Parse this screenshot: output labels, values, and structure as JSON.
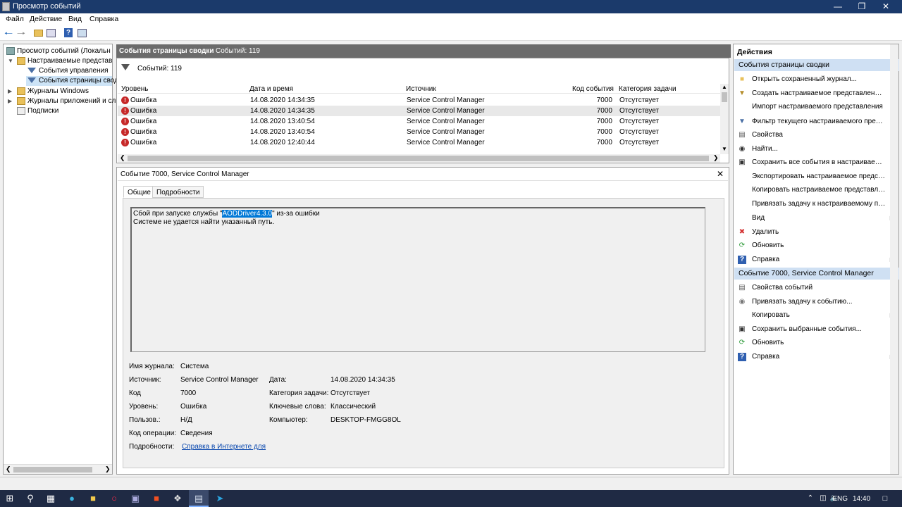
{
  "window": {
    "title": "Просмотр событий"
  },
  "menu": [
    "Файл",
    "Действие",
    "Вид",
    "Справка"
  ],
  "tree": {
    "root": "Просмотр событий (Локальн",
    "custom_views": "Настраиваемые представ",
    "admin_events": "События управления",
    "summary_events": "События страницы свод",
    "windows_logs": "Журналы Windows",
    "app_logs": "Журналы приложений и сл",
    "subscriptions": "Подписки"
  },
  "middle": {
    "header_title": "События страницы сводки",
    "header_count": "Событий: 119",
    "filter_count": "Событий: 119",
    "columns": [
      "Уровень",
      "Дата и время",
      "Источник",
      "Код события",
      "Категория задачи"
    ],
    "rows": [
      {
        "level": "Ошибка",
        "date": "14.08.2020 14:34:35",
        "source": "Service Control Manager",
        "code": "7000",
        "category": "Отсутствует"
      },
      {
        "level": "Ошибка",
        "date": "14.08.2020 14:34:35",
        "source": "Service Control Manager",
        "code": "7000",
        "category": "Отсутствует"
      },
      {
        "level": "Ошибка",
        "date": "14.08.2020 13:40:54",
        "source": "Service Control Manager",
        "code": "7000",
        "category": "Отсутствует"
      },
      {
        "level": "Ошибка",
        "date": "14.08.2020 13:40:54",
        "source": "Service Control Manager",
        "code": "7000",
        "category": "Отсутствует"
      },
      {
        "level": "Ошибка",
        "date": "14.08.2020 12:40:44",
        "source": "Service Control Manager",
        "code": "7000",
        "category": "Отсутствует"
      }
    ]
  },
  "detail": {
    "title": "Событие 7000, Service Control Manager",
    "tabs": [
      "Общие",
      "Подробности"
    ],
    "msg_pre": "Сбой при запуске службы \"",
    "msg_sel": "AODDriver4.3.0",
    "msg_post": "\" из-за ошибки",
    "msg_line2": "Системе не удается найти указанный путь.",
    "fields": {
      "log_label": "Имя журнала:",
      "log_value": "Система",
      "source_label": "Источник:",
      "source_value": "Service Control Manager",
      "date_label": "Дата:",
      "date_value": "14.08.2020 14:34:35",
      "code_label": "Код",
      "code_value": "7000",
      "cat_label": "Категория задачи:",
      "cat_value": "Отсутствует",
      "level_label": "Уровень:",
      "level_value": "Ошибка",
      "keywords_label": "Ключевые слова:",
      "keywords_value": "Классический",
      "user_label": "Пользов.:",
      "user_value": "Н/Д",
      "computer_label": "Компьютер:",
      "computer_value": "DESKTOP-FMGG8OL",
      "opcode_label": "Код операции:",
      "opcode_value": "Сведения",
      "more_label": "Подробности:",
      "more_link": "Справка в Интернете для "
    }
  },
  "actions": {
    "title": "Действия",
    "section1": "События страницы сводки",
    "items1": [
      "Открыть сохраненный журнал...",
      "Создать настраиваемое представление...",
      "Импорт настраиваемого представления",
      "Фильтр текущего настраиваемого предст...",
      "Свойства",
      "Найти...",
      "Сохранить все события в настраиваемом...",
      "Экспортировать настраиваемое представ...",
      "Копировать настраиваемое представлен...",
      "Привязать задачу к настраиваемому пре...",
      "Вид",
      "Удалить",
      "Обновить",
      "Справка"
    ],
    "section2": "Событие 7000, Service Control Manager",
    "items2": [
      "Свойства событий",
      "Привязать задачу к событию...",
      "Копировать",
      "Сохранить выбранные события...",
      "Обновить",
      "Справка"
    ]
  },
  "taskbar": {
    "lang": "ENG",
    "time": "14:40"
  }
}
